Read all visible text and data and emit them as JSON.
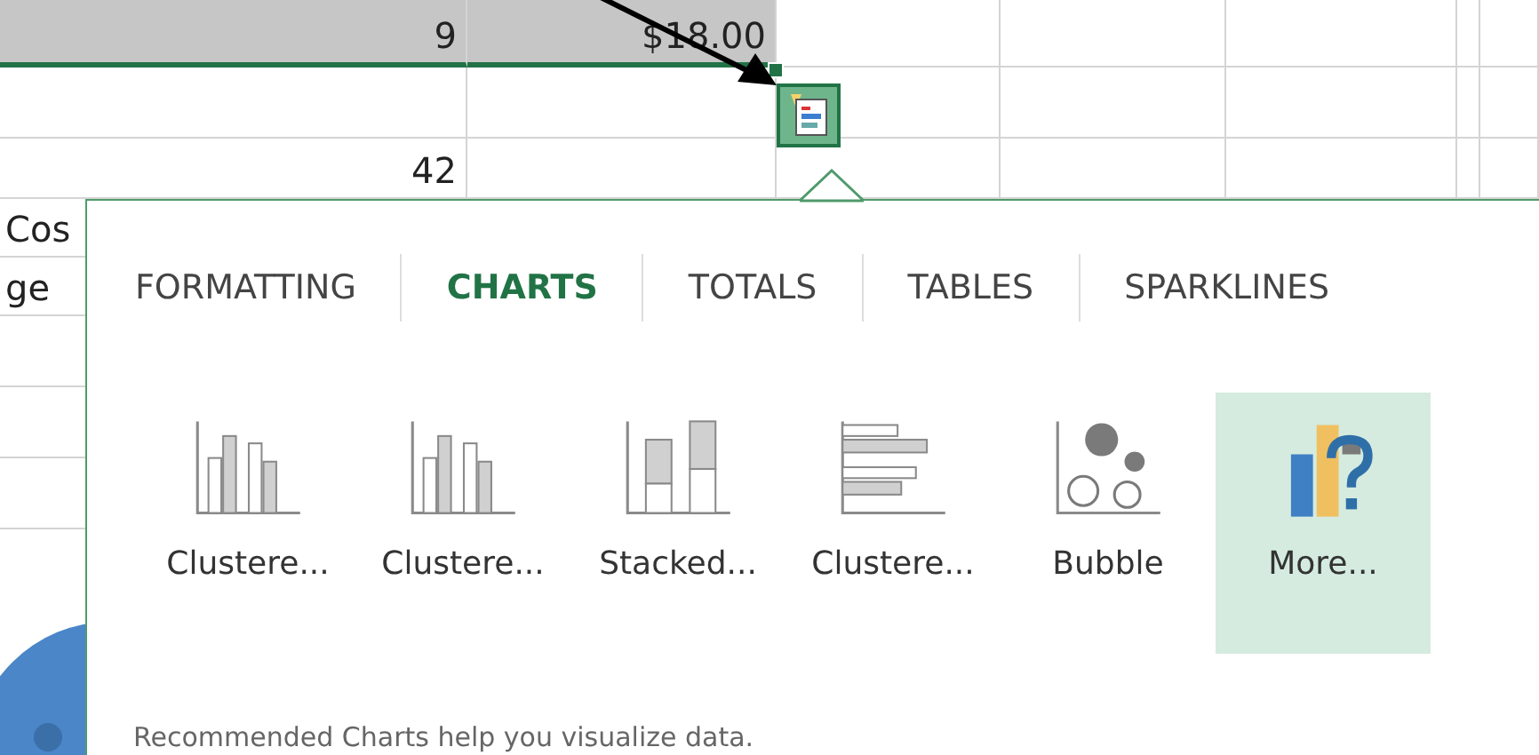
{
  "sheet": {
    "rows": [
      {
        "selected": true,
        "cells": [
          {
            "kind": "number",
            "text": "9"
          },
          {
            "kind": "number",
            "text": "$18.00"
          }
        ]
      },
      {
        "selected": false,
        "cells": []
      },
      {
        "selected": false,
        "cells": [
          {
            "kind": "number",
            "text": "42"
          }
        ]
      },
      {
        "selected": false,
        "cells": [
          {
            "kind": "text",
            "text": "Cos"
          }
        ]
      },
      {
        "selected": false,
        "cells": [
          {
            "kind": "text",
            "text": "ge"
          }
        ]
      },
      {
        "selected": false,
        "cells": []
      },
      {
        "selected": false,
        "cells": []
      },
      {
        "selected": false,
        "cells": []
      }
    ]
  },
  "quick_analysis": {
    "tabs": [
      {
        "label": "FORMATTING",
        "selected": false
      },
      {
        "label": "CHARTS",
        "selected": true
      },
      {
        "label": "TOTALS",
        "selected": false
      },
      {
        "label": "TABLES",
        "selected": false
      },
      {
        "label": "SPARKLINES",
        "selected": false
      }
    ],
    "options": [
      {
        "kind": "clustered-column",
        "label": "Clustere...",
        "selected": false
      },
      {
        "kind": "clustered-column",
        "label": "Clustere...",
        "selected": false
      },
      {
        "kind": "stacked-column",
        "label": "Stacked...",
        "selected": false
      },
      {
        "kind": "clustered-bar",
        "label": "Clustere...",
        "selected": false
      },
      {
        "kind": "bubble",
        "label": "Bubble",
        "selected": false
      },
      {
        "kind": "more",
        "label": "More...",
        "selected": true
      }
    ],
    "description": "Recommended Charts help you visualize data."
  }
}
